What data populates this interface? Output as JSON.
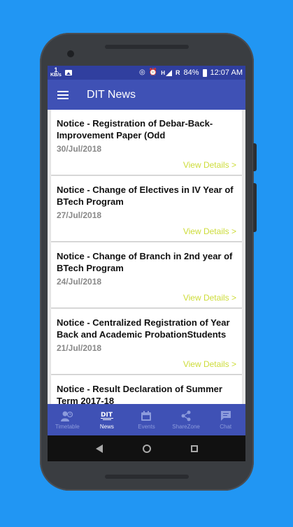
{
  "status_bar": {
    "speed_value": "1",
    "speed_unit": "KB/s",
    "network_label": "H",
    "roaming_label": "R",
    "battery": "84%",
    "time": "12:07 AM"
  },
  "app_bar": {
    "title": "DIT News"
  },
  "news": [
    {
      "title": "Notice - Registration of Debar-Back-Improvement Paper (Odd",
      "date": "30/Jul/2018",
      "link": "View Details >"
    },
    {
      "title": "Notice - Change of Electives in IV Year of BTech Program",
      "date": "27/Jul/2018",
      "link": "View Details >"
    },
    {
      "title": "Notice - Change of Branch in 2nd year of BTech Program",
      "date": "24/Jul/2018",
      "link": "View Details >"
    },
    {
      "title": "Notice - Centralized Registration of Year Back and Academic ProbationStudents",
      "date": "21/Jul/2018",
      "link": "View Details >"
    },
    {
      "title": "Notice - Result Declaration of Summer Term 2017-18",
      "date": "",
      "link": ""
    }
  ],
  "bottom_nav": [
    {
      "label": "Timetable",
      "icon": "timetable-icon",
      "active": false
    },
    {
      "label": "News",
      "icon": "news-icon",
      "active": true
    },
    {
      "label": "Events",
      "icon": "calendar-icon",
      "active": false
    },
    {
      "label": "ShareZone",
      "icon": "share-icon",
      "active": false
    },
    {
      "label": "Chat",
      "icon": "chat-icon",
      "active": false
    }
  ],
  "colors": {
    "primary": "#3f51b5",
    "primary_dark": "#303f9f",
    "accent_link": "#cddc39",
    "background": "#2196f3"
  }
}
